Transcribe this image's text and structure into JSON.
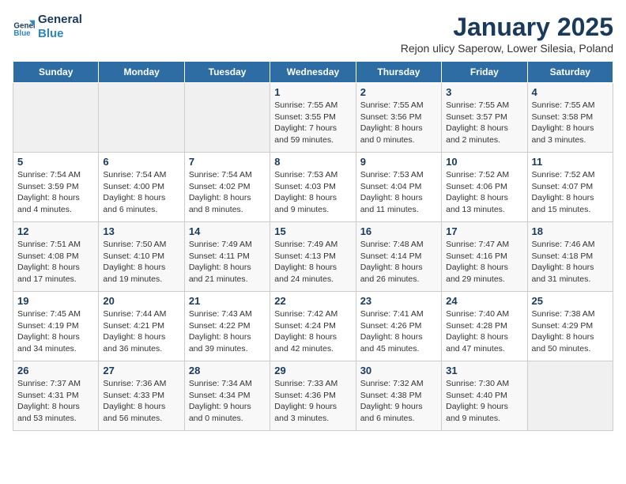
{
  "header": {
    "logo_line1": "General",
    "logo_line2": "Blue",
    "title": "January 2025",
    "subtitle": "Rejon ulicy Saperow, Lower Silesia, Poland"
  },
  "weekdays": [
    "Sunday",
    "Monday",
    "Tuesday",
    "Wednesday",
    "Thursday",
    "Friday",
    "Saturday"
  ],
  "weeks": [
    [
      {
        "day": "",
        "info": ""
      },
      {
        "day": "",
        "info": ""
      },
      {
        "day": "",
        "info": ""
      },
      {
        "day": "1",
        "info": "Sunrise: 7:55 AM\nSunset: 3:55 PM\nDaylight: 7 hours and 59 minutes."
      },
      {
        "day": "2",
        "info": "Sunrise: 7:55 AM\nSunset: 3:56 PM\nDaylight: 8 hours and 0 minutes."
      },
      {
        "day": "3",
        "info": "Sunrise: 7:55 AM\nSunset: 3:57 PM\nDaylight: 8 hours and 2 minutes."
      },
      {
        "day": "4",
        "info": "Sunrise: 7:55 AM\nSunset: 3:58 PM\nDaylight: 8 hours and 3 minutes."
      }
    ],
    [
      {
        "day": "5",
        "info": "Sunrise: 7:54 AM\nSunset: 3:59 PM\nDaylight: 8 hours and 4 minutes."
      },
      {
        "day": "6",
        "info": "Sunrise: 7:54 AM\nSunset: 4:00 PM\nDaylight: 8 hours and 6 minutes."
      },
      {
        "day": "7",
        "info": "Sunrise: 7:54 AM\nSunset: 4:02 PM\nDaylight: 8 hours and 8 minutes."
      },
      {
        "day": "8",
        "info": "Sunrise: 7:53 AM\nSunset: 4:03 PM\nDaylight: 8 hours and 9 minutes."
      },
      {
        "day": "9",
        "info": "Sunrise: 7:53 AM\nSunset: 4:04 PM\nDaylight: 8 hours and 11 minutes."
      },
      {
        "day": "10",
        "info": "Sunrise: 7:52 AM\nSunset: 4:06 PM\nDaylight: 8 hours and 13 minutes."
      },
      {
        "day": "11",
        "info": "Sunrise: 7:52 AM\nSunset: 4:07 PM\nDaylight: 8 hours and 15 minutes."
      }
    ],
    [
      {
        "day": "12",
        "info": "Sunrise: 7:51 AM\nSunset: 4:08 PM\nDaylight: 8 hours and 17 minutes."
      },
      {
        "day": "13",
        "info": "Sunrise: 7:50 AM\nSunset: 4:10 PM\nDaylight: 8 hours and 19 minutes."
      },
      {
        "day": "14",
        "info": "Sunrise: 7:49 AM\nSunset: 4:11 PM\nDaylight: 8 hours and 21 minutes."
      },
      {
        "day": "15",
        "info": "Sunrise: 7:49 AM\nSunset: 4:13 PM\nDaylight: 8 hours and 24 minutes."
      },
      {
        "day": "16",
        "info": "Sunrise: 7:48 AM\nSunset: 4:14 PM\nDaylight: 8 hours and 26 minutes."
      },
      {
        "day": "17",
        "info": "Sunrise: 7:47 AM\nSunset: 4:16 PM\nDaylight: 8 hours and 29 minutes."
      },
      {
        "day": "18",
        "info": "Sunrise: 7:46 AM\nSunset: 4:18 PM\nDaylight: 8 hours and 31 minutes."
      }
    ],
    [
      {
        "day": "19",
        "info": "Sunrise: 7:45 AM\nSunset: 4:19 PM\nDaylight: 8 hours and 34 minutes."
      },
      {
        "day": "20",
        "info": "Sunrise: 7:44 AM\nSunset: 4:21 PM\nDaylight: 8 hours and 36 minutes."
      },
      {
        "day": "21",
        "info": "Sunrise: 7:43 AM\nSunset: 4:22 PM\nDaylight: 8 hours and 39 minutes."
      },
      {
        "day": "22",
        "info": "Sunrise: 7:42 AM\nSunset: 4:24 PM\nDaylight: 8 hours and 42 minutes."
      },
      {
        "day": "23",
        "info": "Sunrise: 7:41 AM\nSunset: 4:26 PM\nDaylight: 8 hours and 45 minutes."
      },
      {
        "day": "24",
        "info": "Sunrise: 7:40 AM\nSunset: 4:28 PM\nDaylight: 8 hours and 47 minutes."
      },
      {
        "day": "25",
        "info": "Sunrise: 7:38 AM\nSunset: 4:29 PM\nDaylight: 8 hours and 50 minutes."
      }
    ],
    [
      {
        "day": "26",
        "info": "Sunrise: 7:37 AM\nSunset: 4:31 PM\nDaylight: 8 hours and 53 minutes."
      },
      {
        "day": "27",
        "info": "Sunrise: 7:36 AM\nSunset: 4:33 PM\nDaylight: 8 hours and 56 minutes."
      },
      {
        "day": "28",
        "info": "Sunrise: 7:34 AM\nSunset: 4:34 PM\nDaylight: 9 hours and 0 minutes."
      },
      {
        "day": "29",
        "info": "Sunrise: 7:33 AM\nSunset: 4:36 PM\nDaylight: 9 hours and 3 minutes."
      },
      {
        "day": "30",
        "info": "Sunrise: 7:32 AM\nSunset: 4:38 PM\nDaylight: 9 hours and 6 minutes."
      },
      {
        "day": "31",
        "info": "Sunrise: 7:30 AM\nSunset: 4:40 PM\nDaylight: 9 hours and 9 minutes."
      },
      {
        "day": "",
        "info": ""
      }
    ]
  ]
}
